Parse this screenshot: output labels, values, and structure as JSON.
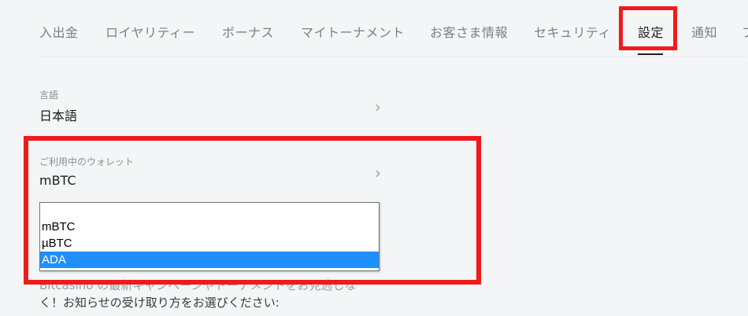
{
  "tabs": [
    {
      "label": "入出金"
    },
    {
      "label": "ロイヤリティー"
    },
    {
      "label": "ボーナス"
    },
    {
      "label": "マイトーナメント"
    },
    {
      "label": "お客さま情報"
    },
    {
      "label": "セキュリティ"
    },
    {
      "label": "設定",
      "active": true
    },
    {
      "label": "通知"
    },
    {
      "label": "フ"
    }
  ],
  "settings": {
    "language": {
      "caption": "言語",
      "value": "日本語"
    },
    "wallet": {
      "caption": "ご利用中のウォレット",
      "value": "mBTC"
    }
  },
  "wallet_dropdown": {
    "options": [
      "mBTC",
      "µBTC",
      "ADA"
    ],
    "highlighted": "ADA"
  },
  "notice": {
    "line1": "Bitcasino の最新キャンペーンやトーナメントをお見逃しな",
    "line2": "く！お知らせの受け取り方をお選びください:"
  },
  "colors": {
    "highlight_border": "#ee1b1b",
    "selected_option": "#1e90ff"
  },
  "icons": {
    "row_chevron": "chevron-right-icon"
  }
}
